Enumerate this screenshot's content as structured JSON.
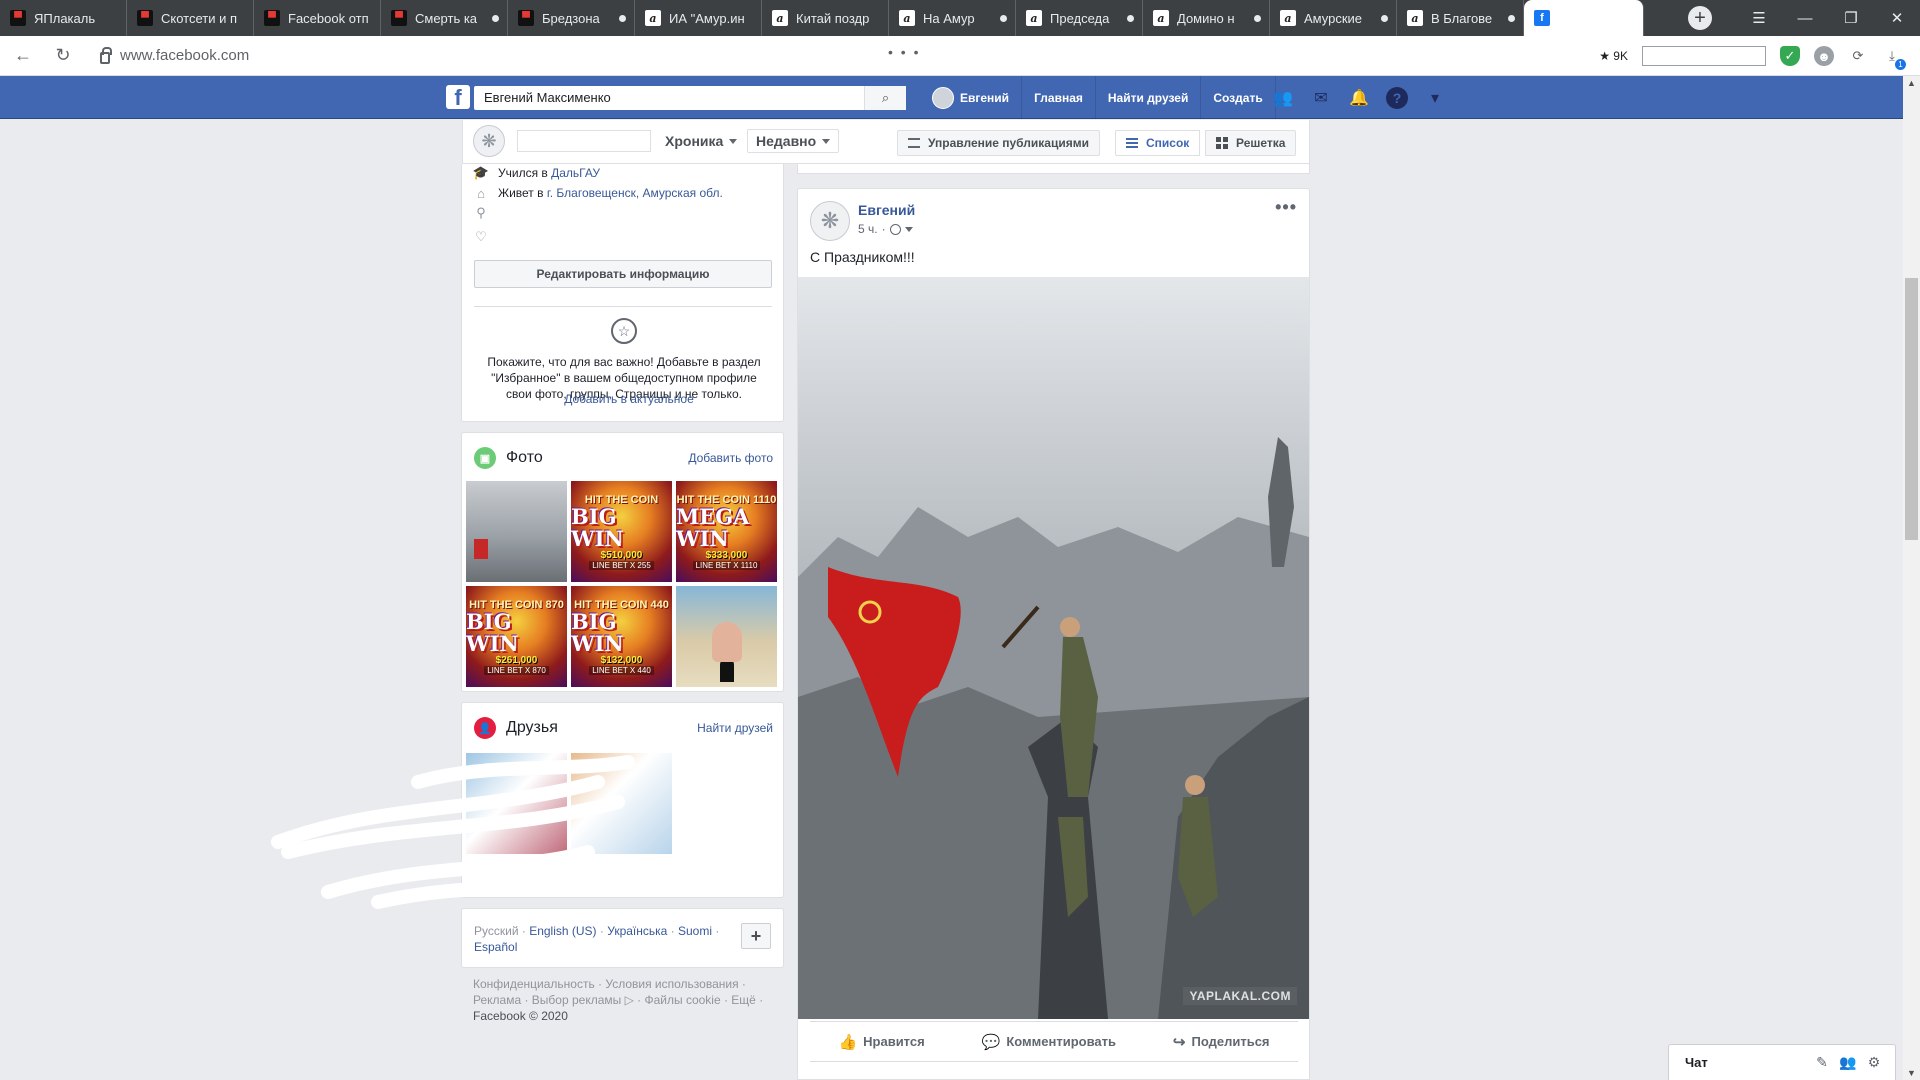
{
  "browser": {
    "tabs": [
      {
        "title": "ЯПлакаль",
        "favicon": "yaplakal-icon",
        "dot": false
      },
      {
        "title": "Скотсети и п",
        "favicon": "yaplakal-icon",
        "dot": false
      },
      {
        "title": "Facebook отп",
        "favicon": "yaplakal-icon",
        "dot": false
      },
      {
        "title": "Смерть ка",
        "favicon": "yaplakal-icon",
        "dot": true
      },
      {
        "title": "Бредзона",
        "favicon": "yaplakal-icon",
        "dot": true
      },
      {
        "title": "ИА \"Амур.ин",
        "favicon": "amur-icon",
        "dot": false
      },
      {
        "title": "Китай поздр",
        "favicon": "amur-icon",
        "dot": false
      },
      {
        "title": "На Амур",
        "favicon": "amur-icon",
        "dot": true
      },
      {
        "title": "Председа",
        "favicon": "amur-icon",
        "dot": true
      },
      {
        "title": "Домино н",
        "favicon": "amur-icon",
        "dot": true
      },
      {
        "title": "Амурские",
        "favicon": "amur-icon",
        "dot": true
      },
      {
        "title": "В Благове",
        "favicon": "amur-icon",
        "dot": true
      },
      {
        "title": "",
        "favicon": "facebook-icon",
        "dot": false,
        "active": true
      }
    ],
    "favicon_glyphs": {
      "yaplakal": "▀",
      "amur": "a",
      "facebook": "f"
    },
    "new_tab": "+",
    "window_controls": [
      "☰",
      "—",
      "❐",
      "✕"
    ],
    "back": "←",
    "reload": "↻",
    "url": "www.facebook.com",
    "url_dots": "• • •",
    "ext_count": "★ 9K",
    "ext_shield": "✓",
    "ext_face": "☻",
    "ext_sync": "⟳",
    "ext_download": "⤓",
    "download_badge": "1"
  },
  "fb": {
    "logo": "f",
    "search_value": "Евгений Максименко",
    "search_icon": "⌕",
    "profile_name": "Евгений",
    "nav": [
      "Главная",
      "Найти друзей",
      "Создать"
    ],
    "icons": {
      "friends": "👥",
      "messenger": "✉",
      "notifications": "🔔",
      "help": "?",
      "menu": "▾"
    }
  },
  "subheader": {
    "avatar_glyph": "❋",
    "tab_timeline": "Хроника",
    "tab_recent": "Недавно",
    "manage_posts": "Управление публикациями",
    "view_list": "Список",
    "view_grid": "Решетка"
  },
  "intro": {
    "rows": [
      {
        "icon": "🎓",
        "text": "Учился в ",
        "link": "ДальГАУ"
      },
      {
        "icon": "⌂",
        "text": "Живет в ",
        "link": "г. Благовещенск, Амурская обл."
      },
      {
        "icon": "⚲",
        "text": "",
        "link": ""
      },
      {
        "icon": "♡",
        "text": "",
        "link": ""
      }
    ],
    "edit_button": "Редактировать информацию",
    "star": "☆",
    "featured_text": "Покажите, что для вас важно! Добавьте в раздел \"Избранное\" в вашем общедоступном профиле свои фото, группы, Страницы и не только.",
    "featured_link": "Добавить в актуальное"
  },
  "photos": {
    "title": "Фото",
    "icon": "▣",
    "add_link": "Добавить фото",
    "tiles": [
      {
        "kind": "ruin"
      },
      {
        "kind": "slot",
        "top": "HIT THE COIN",
        "big": "BIG WIN",
        "amount": "$510,000",
        "line": "LINE BET X 255"
      },
      {
        "kind": "slot",
        "top": "HIT THE COIN 1110",
        "big": "MEGA WIN",
        "amount": "$333,000",
        "line": "LINE BET X 1110"
      },
      {
        "kind": "slot",
        "top": "HIT THE COIN 870",
        "big": "BIG WIN",
        "amount": "$261,000",
        "line": "LINE BET X 870"
      },
      {
        "kind": "slot",
        "top": "HIT THE COIN 440",
        "big": "BIG WIN",
        "amount": "$132,000",
        "line": "LINE BET X 440"
      },
      {
        "kind": "beach"
      }
    ]
  },
  "friends": {
    "title": "Друзья",
    "icon": "👤",
    "find_link": "Найти друзей"
  },
  "languages": {
    "current": "Русский",
    "links": [
      "English (US)",
      "Українська",
      "Suomi",
      "Español"
    ],
    "more": "+"
  },
  "footer": {
    "line1": "Конфиденциальность · Условия использования ·",
    "line2": "Реклама · Выбор рекламы ▷ · Файлы cookie · Ещё ·",
    "copyright": "Facebook © 2020"
  },
  "post": {
    "avatar_glyph": "❋",
    "author": "Евгений",
    "time": "5 ч.",
    "more": "•••",
    "text": "С Праздником!!!",
    "watermark": "YAPLAKAL.COM",
    "actions": [
      {
        "icon": "👍",
        "label": "Нравится"
      },
      {
        "icon": "💬",
        "label": "Комментировать"
      },
      {
        "icon": "↪",
        "label": "Поделиться"
      }
    ]
  },
  "chat": {
    "label": "Чат",
    "icons": [
      "✎",
      "👥",
      "⚙"
    ]
  },
  "scroll": {
    "up": "▲",
    "down": "▼"
  }
}
